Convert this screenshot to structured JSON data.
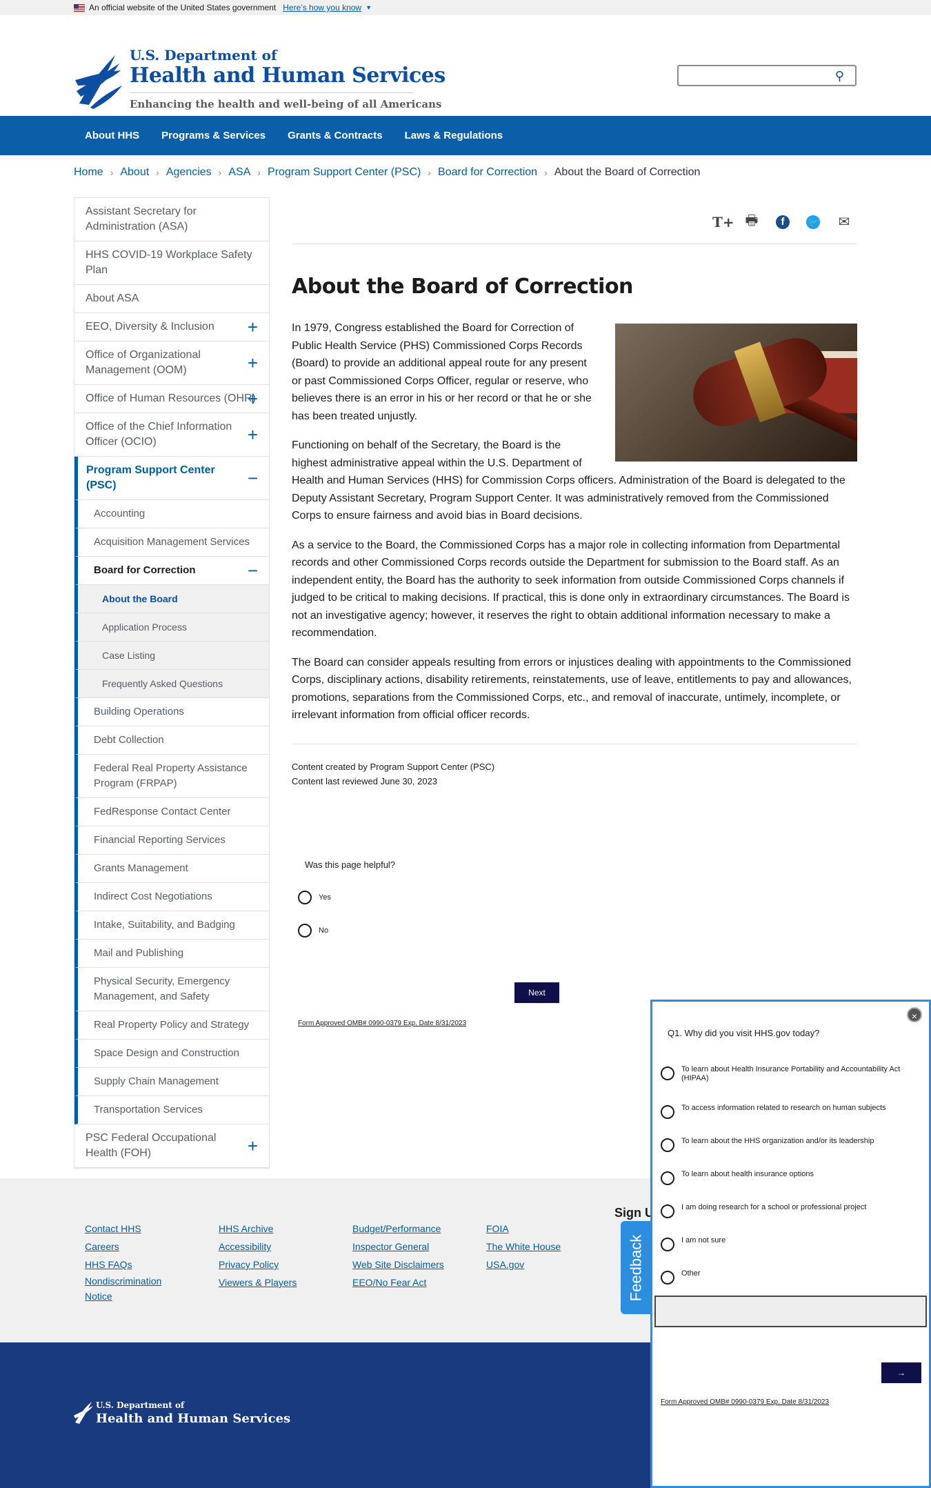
{
  "banner": {
    "text": "An official website of the United States government",
    "link": "Here’s how you know"
  },
  "header": {
    "line1": "U.S. Department of",
    "line2": "Health and Human Services",
    "tagline": "Enhancing the health and well-being of all Americans"
  },
  "nav": [
    "About HHS",
    "Programs & Services",
    "Grants & Contracts",
    "Laws & Regulations"
  ],
  "breadcrumb": [
    "Home",
    "About",
    "Agencies",
    "ASA",
    "Program Support Center (PSC)",
    "Board for Correction"
  ],
  "breadcrumb_current": "About the Board of Correction",
  "sidenav": {
    "top": [
      "Assistant Secretary for Administration (ASA)",
      "HHS COVID-19 Workplace Safety Plan",
      "About ASA"
    ],
    "expand": [
      "EEO, Diversity & Inclusion",
      "Office of Organizational Management (OOM)",
      "Office of Human Resources (OHR)",
      "Office of the Chief Information Officer (OCIO)"
    ],
    "psc": "Program Support Center (PSC)",
    "psc_before": [
      "Accounting",
      "Acquisition Management Services"
    ],
    "bfc": "Board for Correction",
    "bfc_items": [
      "About the Board",
      "Application Process",
      "Case Listing",
      "Frequently Asked Questions"
    ],
    "psc_after": [
      "Building Operations",
      "Debt Collection",
      "Federal Real Property Assistance Program (FRPAP)",
      "FedResponse Contact Center",
      "Financial Reporting Services",
      "Grants Management",
      "Indirect Cost Negotiations",
      "Intake, Suitability, and Badging",
      "Mail and Publishing",
      "Physical Security, Emergency Management, and Safety",
      "Real Property Policy and Strategy",
      "Space Design and Construction",
      "Supply Chain Management",
      "Transportation Services"
    ],
    "last": "PSC Federal Occupational Health (FOH)"
  },
  "tools": {
    "text_size": "T+",
    "print": "🖶",
    "facebook": "f",
    "twitter": "🐦",
    "email": "✉"
  },
  "title": "About the Board of Correction",
  "paragraphs": [
    "In 1979, Congress established the Board for Correction of Public Health Service (PHS) Commissioned Corps Records (Board) to provide an additional appeal route for any present or past Commissioned Corps Officer, regular or reserve, who believes there is an error in his or her record or that he or she has been treated unjustly.",
    "Functioning on behalf of the Secretary, the Board is the highest administrative appeal within the U.S. Department of Health and Human Services (HHS) for Commission Corps officers. Administration of the Board is delegated to the Deputy Assistant Secretary, Program Support Center. It was administratively removed from the Commissioned Corps to ensure fairness and avoid bias in Board decisions.",
    "As a service to the Board, the Commissioned Corps has a major role in collecting information from Departmental records and other Commissioned Corps records outside the Department for submission to the Board staff. As an independent entity, the Board has the authority to seek information from outside Commissioned Corps channels if judged to be critical to making decisions. If practical, this is done only in extraordinary circumstances. The Board is not an investigative agency; however, it reserves the right to obtain additional information necessary to make a recommendation.",
    "The Board can consider appeals resulting from errors or injustices dealing with appointments to the Commissioned Corps, disciplinary actions, disability retirements, reinstatements, use of leave, entitlements to pay and allowances, promotions, separations from the Commissioned Corps, etc., and removal of inaccurate, untimely, incomplete, or irrelevant information from official officer records."
  ],
  "content_created": "Content created by Program Support Center (PSC)",
  "content_reviewed": "Content last reviewed June 30, 2023",
  "poll": {
    "question": "Was this page helpful?",
    "yes": "Yes",
    "no": "No",
    "next": "Next",
    "omb": "Form Approved OMB# 0990-0379 Exp. Date 8/31/2023"
  },
  "footer": {
    "col1": [
      "Contact HHS",
      "Careers",
      "HHS FAQs",
      "Nondiscrimination Notice"
    ],
    "col2": [
      "HHS Archive",
      "Accessibility",
      "Privacy Policy",
      "Viewers & Players"
    ],
    "col3": [
      "Budget/Performance",
      "Inspector General",
      "Web Site Disclaimers",
      "EEO/No Fear Act"
    ],
    "col4": [
      "FOIA",
      "The White House",
      "USA.gov"
    ],
    "signup": "Sign U",
    "logo1": "U.S. Department of",
    "logo2": "Health and Human Services"
  },
  "feedback": {
    "tab": "Feedback",
    "close": "×",
    "question": "Q1. Why did you visit HHS.gov today?",
    "options": [
      "To learn about Health Insurance Portability and Accountability Act (HIPAA)",
      "To access information related to research on human subjects",
      "To learn about the HHS organization and/or its leadership",
      "To learn about health insurance options",
      "I am doing research for a school or professional project",
      "I am not sure",
      "Other"
    ],
    "next": "→",
    "omb": "Form Approved OMB# 0990-0379 Exp. Date 8/31/2023"
  },
  "colors": {
    "brand": "#0b4ea2",
    "nav": "#0b5ea8",
    "footer": "#1a3a80",
    "feedback": "#2d8ee0"
  }
}
